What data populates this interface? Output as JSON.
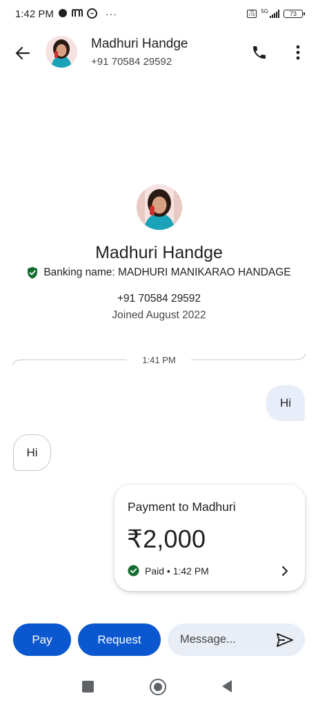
{
  "status_bar": {
    "time": "1:42 PM",
    "notification_icons": [
      "whatsapp-icon",
      "gmail-m-icon",
      "messenger-icon"
    ],
    "more_indicator": "···",
    "network_badge": "Vo LTE",
    "network_type": "5G",
    "battery": "73"
  },
  "header": {
    "contact_name": "Madhuri Handge",
    "contact_phone": "+91 70584 29592"
  },
  "profile": {
    "name": "Madhuri Handge",
    "banking_name": "Banking name: MADHURI MANIKARAO HANDAGE",
    "phone": "+91 70584 29592",
    "joined": "Joined August 2022"
  },
  "chat": {
    "divider_time": "1:41 PM",
    "messages": [
      {
        "direction": "outgoing",
        "text": "Hi"
      },
      {
        "direction": "incoming",
        "text": "Hi"
      }
    ],
    "payment": {
      "title": "Payment to Madhuri",
      "amount": "₹2,000",
      "status": "Paid • 1:42 PM"
    }
  },
  "actions": {
    "pay_label": "Pay",
    "request_label": "Request",
    "message_placeholder": "Message..."
  },
  "colors": {
    "primary": "#0b57d0",
    "verified_green": "#146c2e",
    "bubble_out_bg": "#e8eef9",
    "input_bg": "#e9eef6",
    "text_primary": "#1f1f1f",
    "text_secondary": "#444746"
  }
}
